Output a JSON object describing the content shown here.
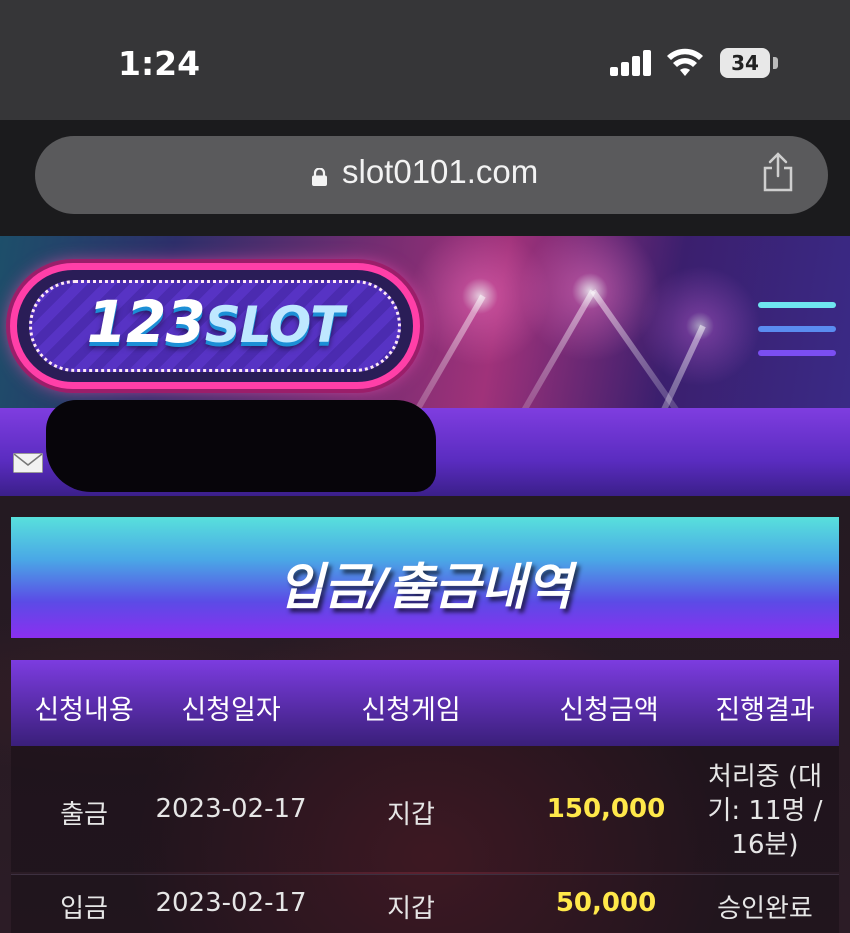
{
  "status_bar": {
    "time": "1:24",
    "battery": "34",
    "icons": [
      "signal-icon",
      "wifi-icon",
      "battery-icon"
    ]
  },
  "browser": {
    "url": "slot0101.com",
    "icons": [
      "lock-icon",
      "share-icon"
    ]
  },
  "site": {
    "logo_number": "123",
    "logo_word": "SLOT",
    "icons": [
      "menu-icon",
      "mail-icon"
    ]
  },
  "page": {
    "title": "입금/출금내역"
  },
  "table": {
    "headers": [
      "신청내용",
      "신청일자",
      "신청게임",
      "신청금액",
      "진행결과"
    ],
    "rows": [
      {
        "type": "출금",
        "date": "2023-02-17",
        "game": "지갑",
        "amount": "150,000",
        "result_lines": [
          "처리중 (대",
          "기: 11명 /",
          "16분)"
        ]
      },
      {
        "type": "입금",
        "date": "2023-02-17",
        "game": "지갑",
        "amount": "50,000",
        "result_lines": [
          "승인완료"
        ]
      }
    ]
  },
  "colors": {
    "amount": "#ffe84a",
    "header_purple": "#7c3ce0",
    "title_cyan": "#58e0dc",
    "logo_pink": "#ff3fa8"
  }
}
